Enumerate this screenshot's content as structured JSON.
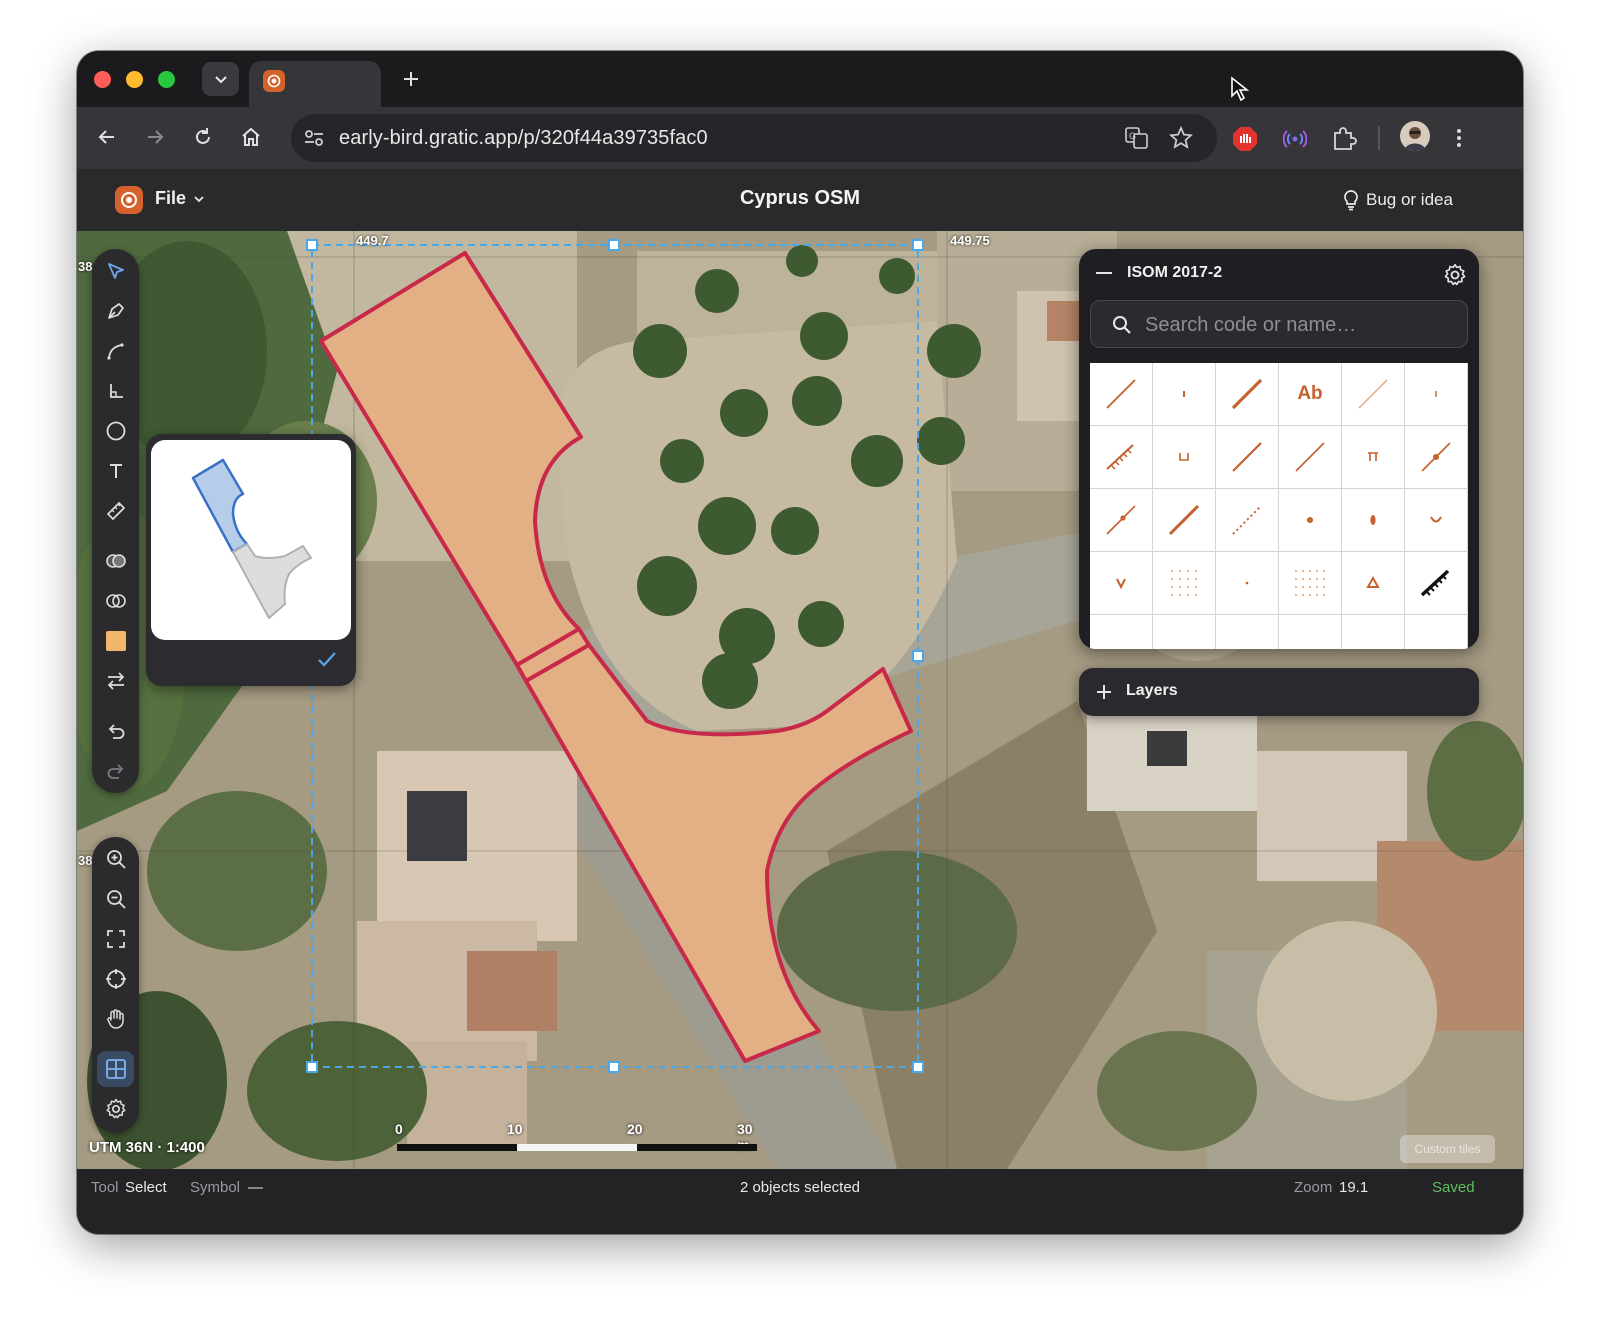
{
  "browser": {
    "url": "early-bird.gratic.app/p/320f44a39735fac0"
  },
  "app": {
    "file_menu": "File",
    "title": "Cyprus OSM",
    "bug_button": "Bug or idea"
  },
  "map": {
    "coord_top_left": "449.7",
    "coord_top_right": "449.75",
    "coord_left_1": "38",
    "coord_left_2": "38",
    "projection": "UTM 36N · 1:400",
    "scalebar_labels": [
      "0",
      "10",
      "20",
      "30 m"
    ],
    "tiles_badge": "Custom tiles"
  },
  "symbol_panel": {
    "title": "ISOM 2017-2",
    "search_placeholder": "Search code or name…",
    "text_symbol": "Ab",
    "icons": [
      "minus-icon",
      "gear-icon",
      "search-icon"
    ]
  },
  "layers": {
    "label": "Layers"
  },
  "tools": [
    "select",
    "pen",
    "curve",
    "angle",
    "circle",
    "text",
    "measure",
    "union",
    "intersect",
    "fill",
    "swap",
    "undo",
    "redo"
  ],
  "view_tools": [
    "zoom-in",
    "zoom-out",
    "fit",
    "locate",
    "pan",
    "grid",
    "settings"
  ],
  "status": {
    "tool_label": "Tool",
    "tool_value": "Select",
    "symbol_label": "Symbol",
    "symbol_value": "—",
    "selection": "2 objects selected",
    "zoom_label": "Zoom",
    "zoom_value": "19.1",
    "save_state": "Saved"
  },
  "colors": {
    "area_fill": "#e2b084",
    "area_stroke": "#c8294a",
    "selection": "#4aa7e8",
    "accent": "#d4622a",
    "saved": "#5cc05c"
  }
}
